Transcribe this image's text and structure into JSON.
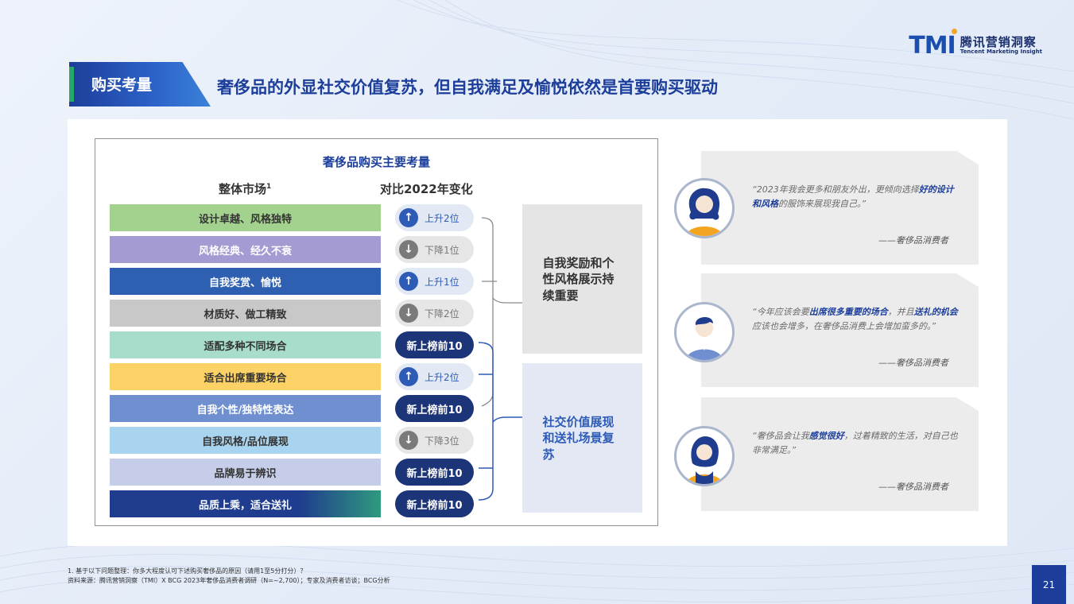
{
  "brand": {
    "logo_mark": "TMI",
    "logo_cn": "腾讯营销洞察",
    "logo_en": "Tencent Marketing Insight"
  },
  "section_tag": "购买考量",
  "headline": "奢侈品的外显社交价值复苏，但自我满足及愉悦依然是首要购买驱动",
  "chart": {
    "title": "奢侈品购买主要考量",
    "col_left": "整体市场",
    "col_left_sup": "1",
    "col_right": "对比2022年变化",
    "rows": [
      {
        "label": "设计卓越、风格独特",
        "bar_color": "#a3d28e",
        "text_color": "#333333",
        "change": "上升2位",
        "kind": "up"
      },
      {
        "label": "风格经典、经久不衰",
        "bar_color": "#a49bd2",
        "text_color": "#ffffff",
        "change": "下降1位",
        "kind": "down"
      },
      {
        "label": "自我奖赏、愉悦",
        "bar_color": "#2f5fb0",
        "text_color": "#ffffff",
        "change": "上升1位",
        "kind": "up"
      },
      {
        "label": "材质好、做工精致",
        "bar_color": "#c8c8c8",
        "text_color": "#333333",
        "change": "下降2位",
        "kind": "down"
      },
      {
        "label": "适配多种不同场合",
        "bar_color": "#a8dccb",
        "text_color": "#333333",
        "change": "新上榜前10",
        "kind": "new"
      },
      {
        "label": "适合出席重要场合",
        "bar_color": "#fcd266",
        "text_color": "#333333",
        "change": "上升2位",
        "kind": "up"
      },
      {
        "label": "自我个性/独特性表达",
        "bar_color": "#6f8fd0",
        "text_color": "#ffffff",
        "change": "新上榜前10",
        "kind": "new"
      },
      {
        "label": "自我风格/品位展现",
        "bar_color": "#a9d4f0",
        "text_color": "#333333",
        "change": "下降3位",
        "kind": "down"
      },
      {
        "label": "品牌易于辨识",
        "bar_color": "#c5cde9",
        "text_color": "#333333",
        "change": "新上榜前10",
        "kind": "new"
      },
      {
        "label": "品质上乘，适合送礼",
        "bar_color": "#1f3c8e",
        "text_color": "#ffffff",
        "change": "新上榜前10",
        "kind": "new"
      }
    ],
    "group_top": "自我奖励和个性风格展示持续重要",
    "group_bottom": "社交价值展现和送礼场景复苏"
  },
  "quotes": [
    {
      "pre": "“2023年我会更多和朋友外出，更倾向选择",
      "hl1": "好的设计和风格",
      "mid": "的服饰来展现我自己。”",
      "hl2": "",
      "post": "",
      "source": "——奢侈品消费者"
    },
    {
      "pre": "“今年应该会要",
      "hl1": "出席很多重要的场合",
      "mid": "，并且",
      "hl2": "送礼的机会",
      "post": "应该也会增多，在奢侈品消费上会增加蛮多的。”",
      "source": "——奢侈品消费者"
    },
    {
      "pre": "“奢侈品会让我",
      "hl1": "感觉很好",
      "mid": "，过着精致的生活，对自己也非常满足。”",
      "hl2": "",
      "post": "",
      "source": "——奢侈品消费者"
    }
  ],
  "footnote_1": "1. 基于以下问题整理：你多大程度认可下述购买奢侈品的原因（请用1至5分打分）？",
  "footnote_2": "资料来源：腾讯营销洞察（TMI）X BCG 2023年奢侈品消费者调研（N=~2,700）；专家及消费者访谈；BCG分析",
  "page_number": "21",
  "icons": {
    "up": "arrow-up-icon",
    "down": "arrow-down-icon"
  }
}
